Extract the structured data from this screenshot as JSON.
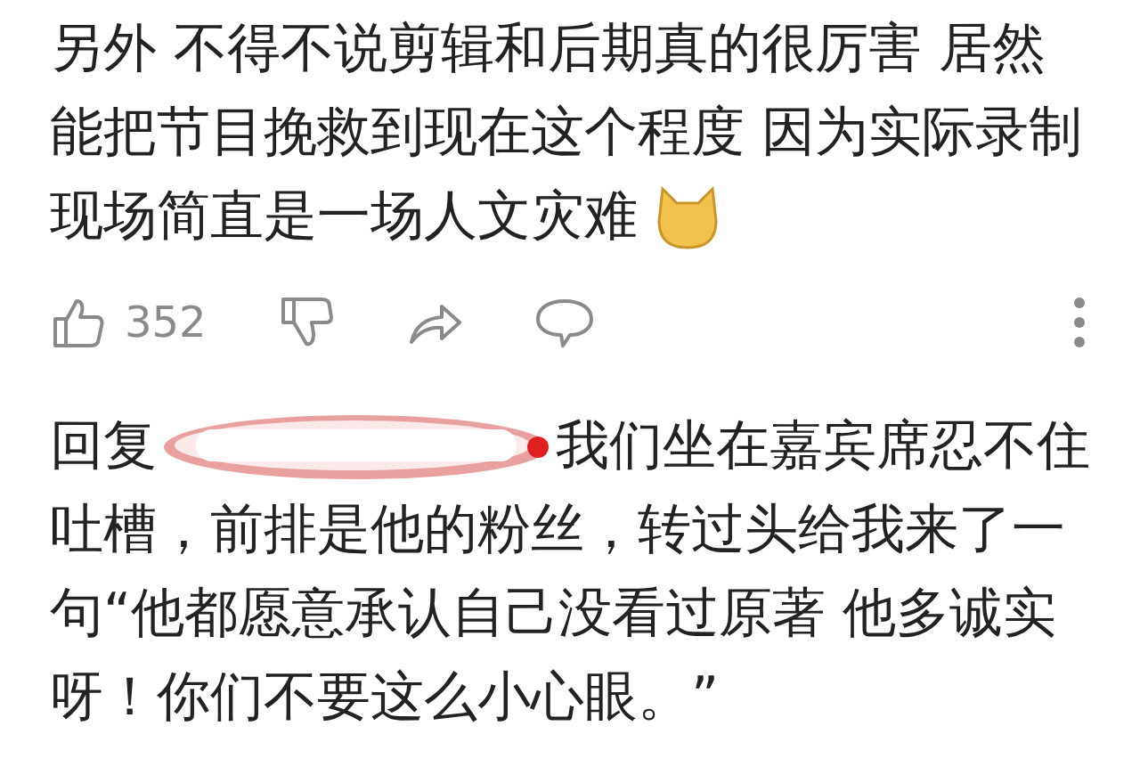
{
  "comment": {
    "lines": [
      "另外 不得不说剪辑和后期真的很厉害 居然",
      "能把节目挽救到现在这个程度 因为实际录制",
      "现场简直是一场人文灾难"
    ],
    "emoji": true
  },
  "actions": {
    "like_count": "352"
  },
  "reply": {
    "prefix": "回复",
    "first_line": "我们坐在嘉宾席忍不住",
    "lines": [
      "吐槽，前排是他的粉丝，转过头给我来了一",
      "句“他都愿意承认自己没看过原著 他多诚实",
      "呀！你们不要这么小心眼。”"
    ]
  }
}
